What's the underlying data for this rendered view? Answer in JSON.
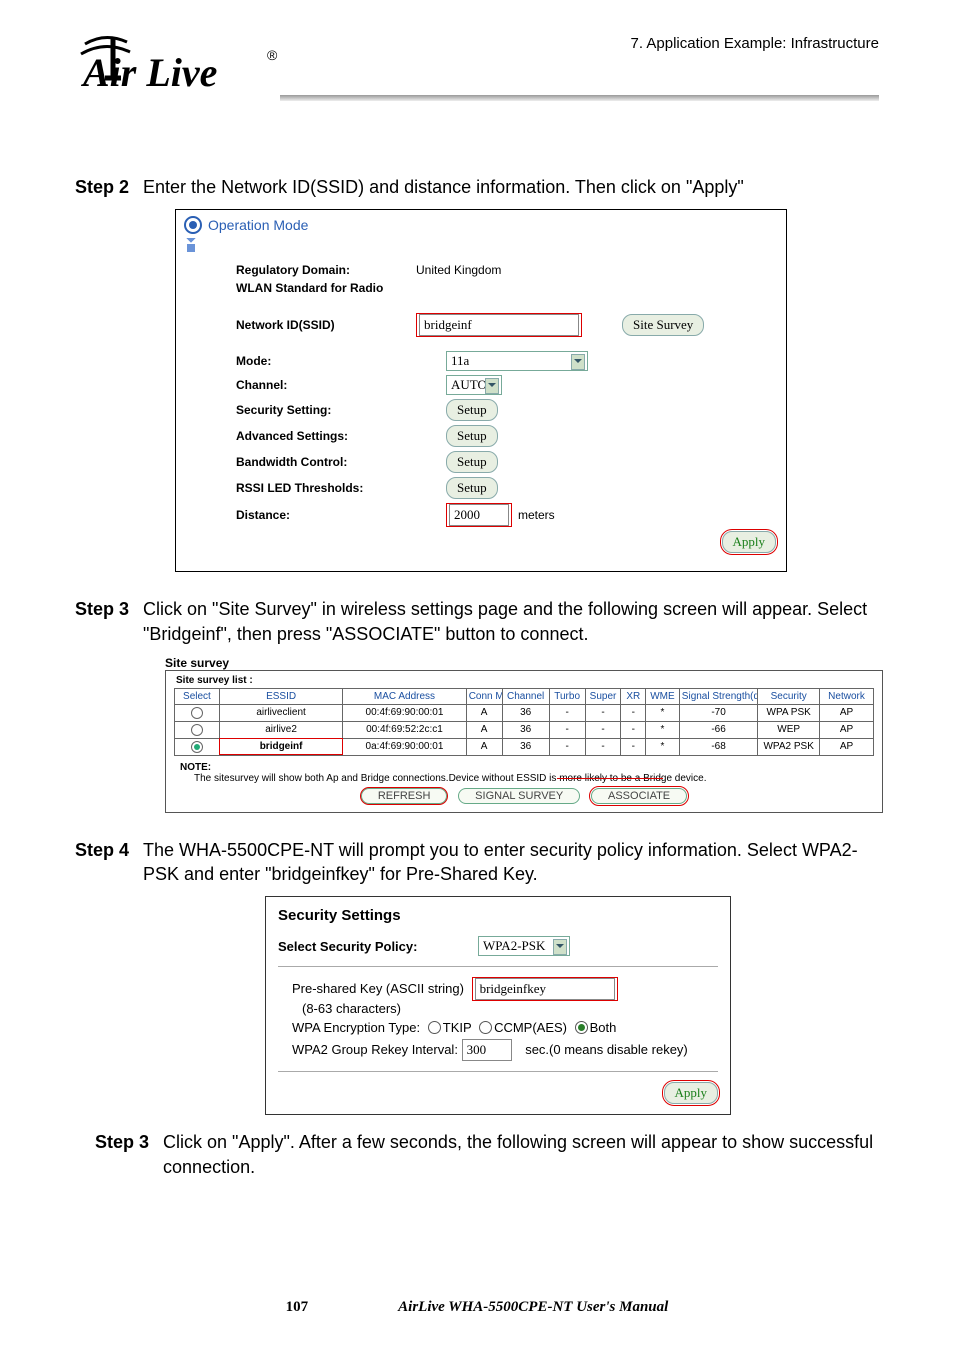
{
  "header": {
    "chapter": "7.  Application  Example:  Infrastructure",
    "logo_text": "Air Live",
    "logo_reg": "®"
  },
  "step2": {
    "label": "Step 2",
    "text": "Enter the Network ID(SSID) and distance information.    Then click on \"Apply\""
  },
  "opmode": {
    "title": "Operation Mode",
    "reg_label": "Regulatory Domain:",
    "reg_value": "United Kingdom",
    "wlan_label": "WLAN Standard for Radio",
    "ssid_label": "Network ID(SSID)",
    "ssid_value": "bridgeinf",
    "site_survey_btn": "Site Survey",
    "mode_label": "Mode:",
    "mode_value": "11a",
    "channel_label": "Channel:",
    "channel_value": "AUTO",
    "sec_label": "Security Setting:",
    "adv_label": "Advanced Settings:",
    "bw_label": "Bandwidth Control:",
    "rssi_label": "RSSI LED Thresholds:",
    "setup_btn": "Setup",
    "dist_label": "Distance:",
    "dist_value": "2000",
    "dist_unit": "meters",
    "apply_btn": "Apply"
  },
  "step3a": {
    "label": "Step 3",
    "text1": "Click on \"Site Survey\" in wireless settings page and the following screen will appear.    Select \"Bridgeinf\", then press \"ASSOCIATE\" button to connect."
  },
  "survey": {
    "title": "Site survey",
    "list_label": "Site survey list :",
    "headers": [
      "Select",
      "ESSID",
      "MAC Address",
      "Conn Mode",
      "Channel",
      "Turbo",
      "Super",
      "XR",
      "WME",
      "Signal Strength(dbm)",
      "Security",
      "Network"
    ],
    "rows": [
      {
        "select": false,
        "essid": "airliveclient",
        "mac": "00:4f:69:90:00:01",
        "conn": "A",
        "ch": "36",
        "turbo": "-",
        "super": "-",
        "xr": "-",
        "wme": "*",
        "sig": "-70",
        "sec": "WPA PSK",
        "net": "AP"
      },
      {
        "select": false,
        "essid": "airlive2",
        "mac": "00:4f:69:52:2c:c1",
        "conn": "A",
        "ch": "36",
        "turbo": "-",
        "super": "-",
        "xr": "-",
        "wme": "*",
        "sig": "-66",
        "sec": "WEP",
        "net": "AP"
      },
      {
        "select": true,
        "essid": "bridgeinf",
        "mac": "0a:4f:69:90:00:01",
        "conn": "A",
        "ch": "36",
        "turbo": "-",
        "super": "-",
        "xr": "-",
        "wme": "*",
        "sig": "-68",
        "sec": "WPA2 PSK",
        "net": "AP"
      }
    ],
    "note_label": "NOTE:",
    "note_text_a": "The sitesurvey will show both Ap and Bridge connections.Device without ESSID is ",
    "note_text_b": "more likely to be a Brid",
    "note_text_c": "ge device.",
    "btn_refresh": "REFRESH",
    "btn_signal": "SIGNAL SURVEY",
    "btn_assoc": "ASSOCIATE"
  },
  "step4": {
    "label": "Step 4",
    "text": "The WHA-5500CPE-NT will prompt you to enter security policy information.   Select WPA2-PSK and enter \"bridgeinfkey\" for Pre-Shared Key."
  },
  "sec": {
    "title": "Security Settings",
    "policy_label": "Select Security Policy:",
    "policy_value": "WPA2-PSK",
    "psk_label": "Pre-shared Key (ASCII string)",
    "psk_hint": "(8-63 characters)",
    "psk_value": "bridgeinfkey",
    "enc_label": "WPA Encryption Type:",
    "enc_tkip": "TKIP",
    "enc_ccmp": "CCMP(AES)",
    "enc_both": "Both",
    "rekey_label": "WPA2 Group Rekey Interval:",
    "rekey_value": "300",
    "rekey_unit": "sec.(0 means disable rekey)",
    "apply_btn": "Apply"
  },
  "step3b": {
    "label": "Step 3",
    "text": "Click on \"Apply\".    After a few seconds, the following screen will appear to show successful connection."
  },
  "footer": {
    "page": "107",
    "manual": "AirLive  WHA-5500CPE-NT  User's  Manual"
  }
}
